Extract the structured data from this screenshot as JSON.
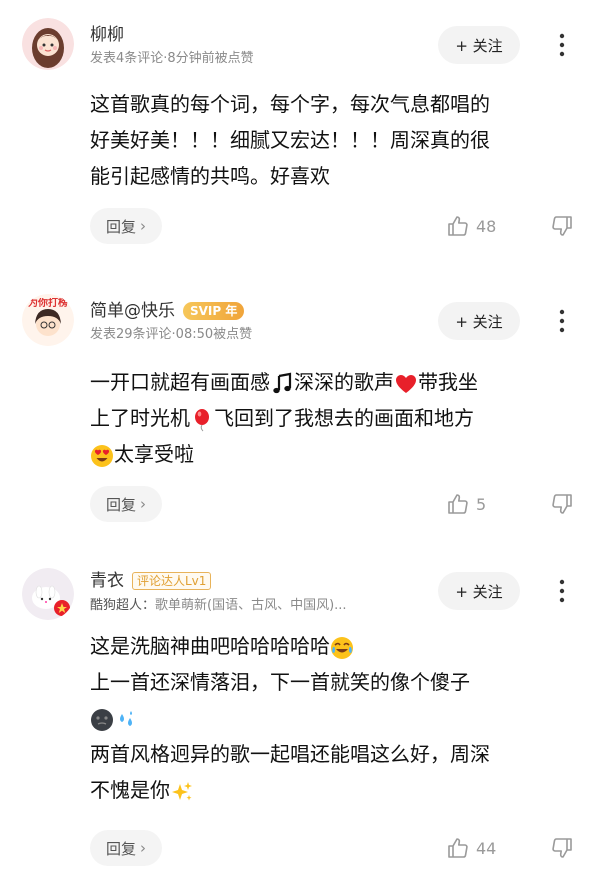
{
  "comments": [
    {
      "username": "柳柳",
      "badge": "",
      "meta": "发表4条评论·8分钟前被点赞",
      "follow_label": "+ 关注",
      "lines": [
        "这首歌真的每个词，每个字，每次气息都唱的",
        "好美好美！！！细腻又宏达！！！周深真的很",
        "能引起感情的共鸣。好喜欢"
      ],
      "reply_label": "回复",
      "likes": "48"
    },
    {
      "username": "简单@快乐",
      "badge": "SVIP 年",
      "avatar_text": "为你打榜",
      "meta": "发表29条评论·08:50被点赞",
      "follow_label": "+ 关注",
      "lines_a": [
        "一开口就超有画面感",
        "深深的歌声",
        "带我坐"
      ],
      "lines_b": [
        "上了时光机",
        "飞回到了我想去的画面和地方"
      ],
      "lines_c": [
        "太享受啦"
      ],
      "reply_label": "回复",
      "likes": "5"
    },
    {
      "username": "青衣",
      "badge": "评论达人Lv1",
      "meta_prefix": "酷狗超人：",
      "meta": "歌单萌新(国语、古风、中国风)...",
      "follow_label": "+ 关注",
      "line1": "这是洗脑神曲吧哈哈哈哈哈",
      "line2": "上一首还深情落泪，下一首就笑的像个傻子",
      "line4": "两首风格迥异的歌一起唱还能唱这么好，周深",
      "line5": "不愧是你",
      "reply_label": "回复",
      "likes": "44"
    }
  ],
  "icons": {
    "follow": "plus",
    "more": "vertical-ellipsis-icon",
    "like": "thumbs-up-icon",
    "dislike": "thumbs-down-icon",
    "reply_chevron": "chevron-right-icon"
  },
  "colors": {
    "meta_text": "#8a8a8a",
    "button_bg": "#f3f3f3",
    "svip_gold": "#f0a43a",
    "talent_badge": "#e0a033"
  }
}
